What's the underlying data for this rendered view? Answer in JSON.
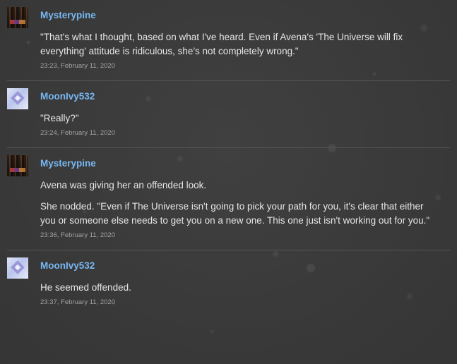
{
  "comments": [
    {
      "author": "Mysterypine",
      "avatar_icon": "mysterypine-avatar",
      "paragraphs": [
        "\"That's what I thought, based on what I've heard. Even if Avena's 'The Universe will fix everything' attitude is ridiculous, she's not completely wrong.\""
      ],
      "timestamp": "23:23, February 11, 2020"
    },
    {
      "author": "MoonIvy532",
      "avatar_icon": "moonivy532-avatar",
      "paragraphs": [
        "\"Really?\""
      ],
      "timestamp": "23:24, February 11, 2020"
    },
    {
      "author": "Mysterypine",
      "avatar_icon": "mysterypine-avatar",
      "paragraphs": [
        "Avena was giving her an offended look.",
        "She nodded. \"Even if The Universe isn't going to pick your path for you, it's clear that either you or someone else needs to get you on a new one. This one just isn't working out for you.\""
      ],
      "timestamp": "23:36, February 11, 2020"
    },
    {
      "author": "MoonIvy532",
      "avatar_icon": "moonivy532-avatar",
      "paragraphs": [
        "He seemed offended."
      ],
      "timestamp": "23:37, February 11, 2020"
    }
  ],
  "colors": {
    "username": "#77b7f1",
    "text": "#e6e6e6",
    "timestamp": "#a3a3a3",
    "background": "#3a3a3a",
    "divider": "#565656"
  }
}
